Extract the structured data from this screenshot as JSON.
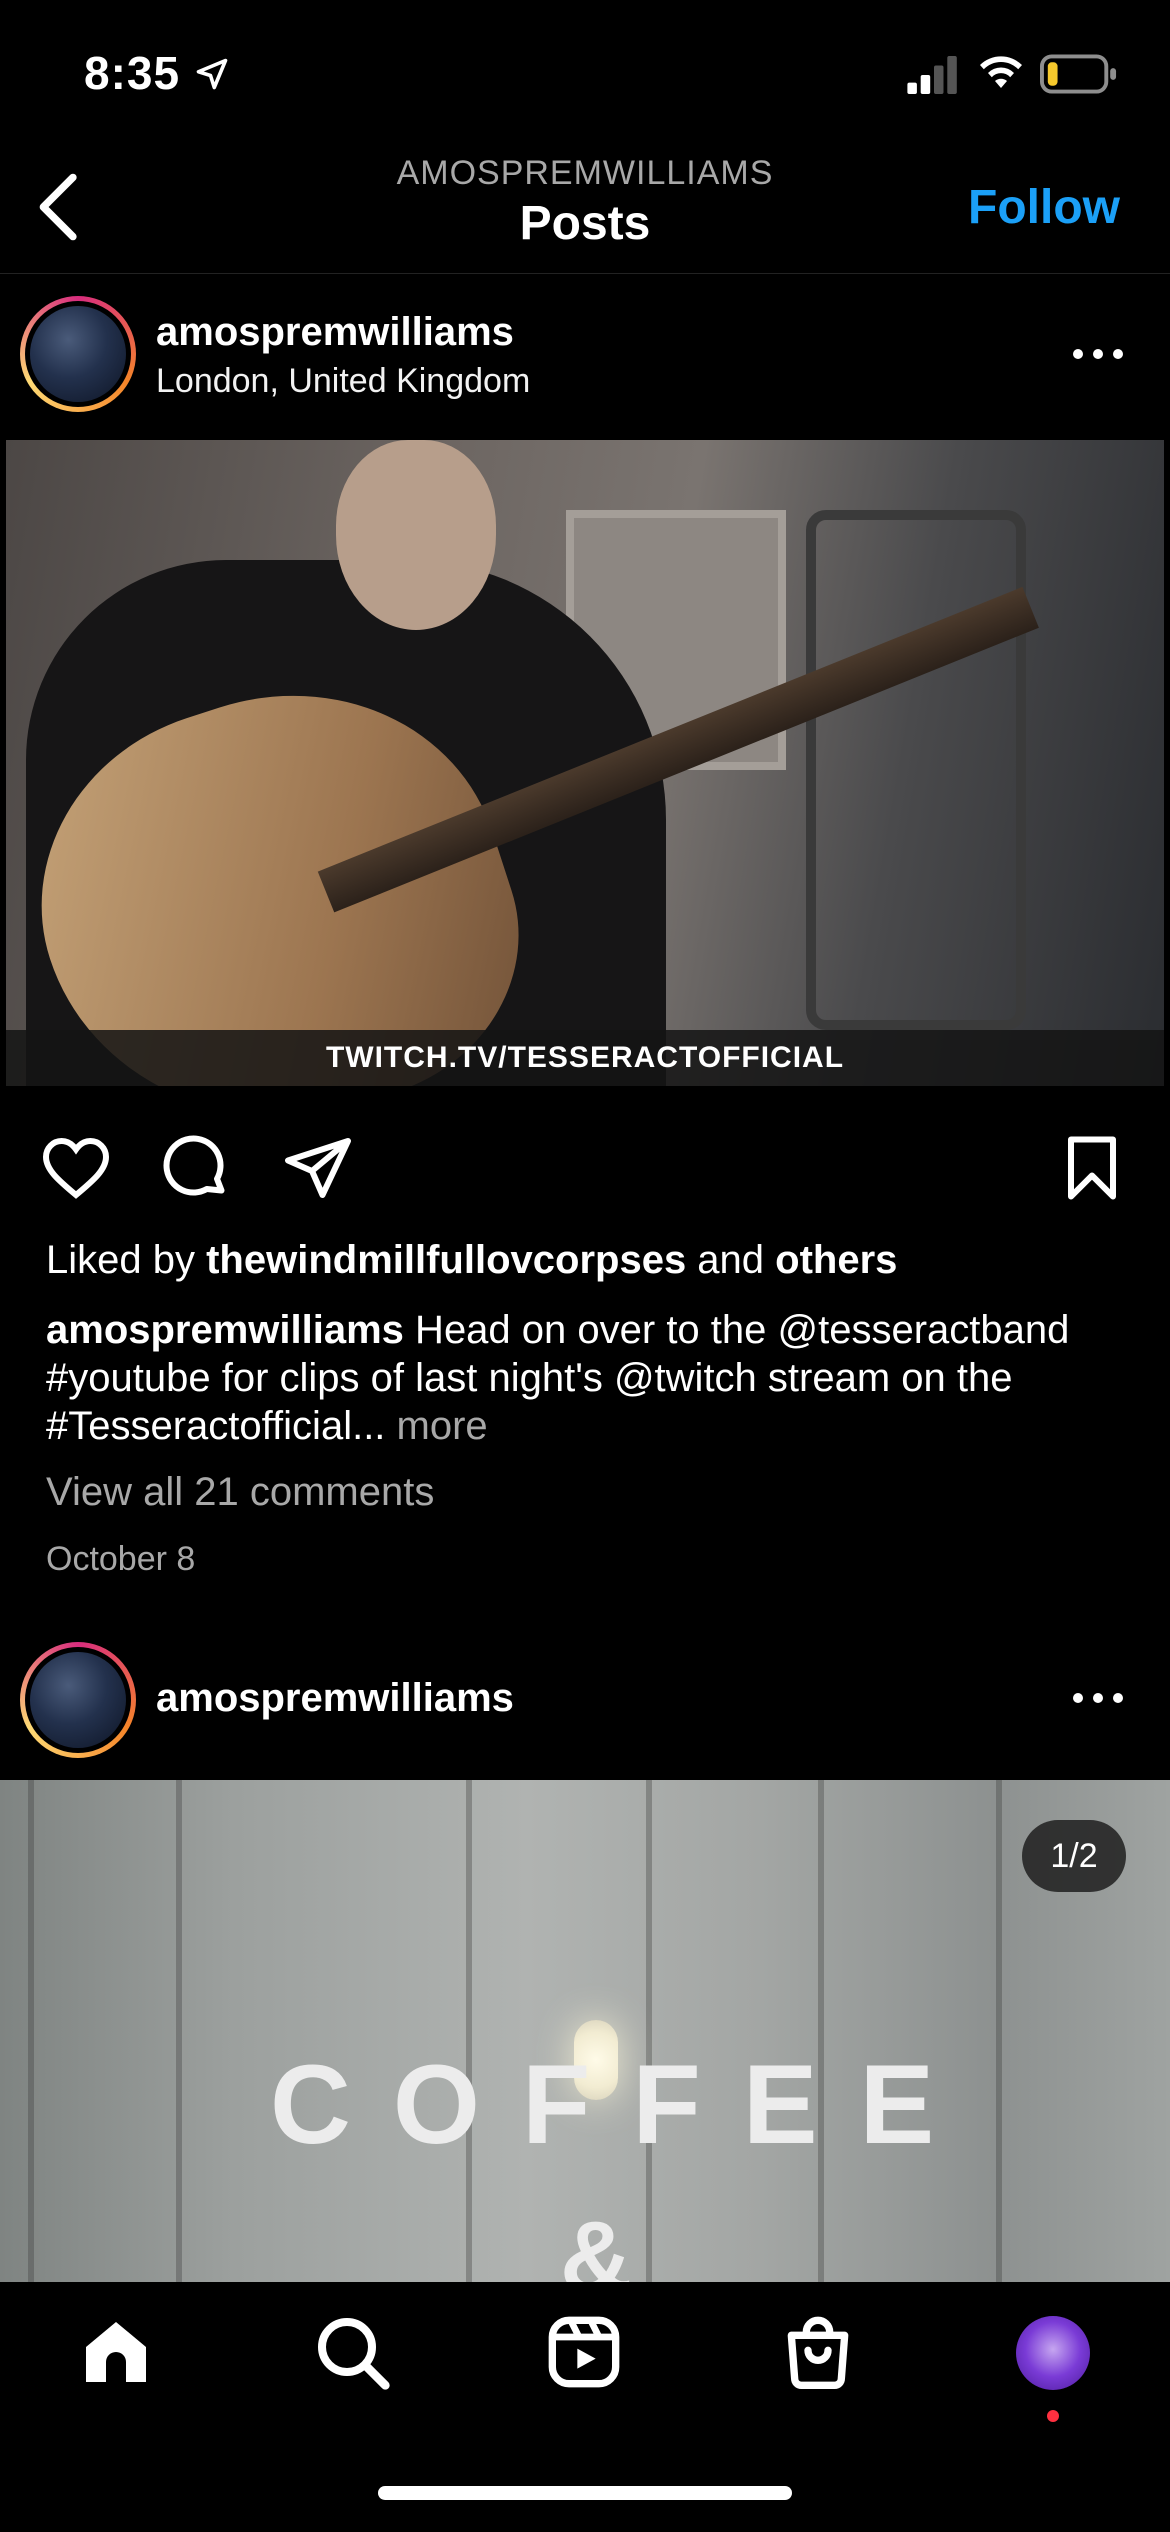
{
  "status_bar": {
    "time": "8:35"
  },
  "header": {
    "username": "AMOSPREMWILLIAMS",
    "title": "Posts",
    "follow_label": "Follow"
  },
  "posts": [
    {
      "username": "amospremwilliams",
      "location": "London, United Kingdom",
      "image_overlay_text": "TWITCH.TV/TESSERACTOFFICIAL",
      "liked_by_prefix": "Liked by ",
      "liked_by_user": "thewindmillfullovcorpses",
      "liked_by_middle": " and ",
      "liked_by_others": "others",
      "caption_user": "amospremwilliams",
      "caption_text": " Head on over to the @tesseractband #youtube for clips of last night's @twitch stream on the #Tesseractofficial...",
      "caption_more": " more",
      "view_comments": "View all 21 comments",
      "date": "October 8"
    },
    {
      "username": "amospremwilliams",
      "page_counter": "1/2",
      "image_text_1": "COFFEE",
      "image_text_2": "&"
    }
  ],
  "tab_bar": {
    "items": [
      "home-icon",
      "search-icon",
      "reels-icon",
      "shop-icon",
      "profile-avatar"
    ]
  },
  "colors": {
    "accent": "#1ba0f7",
    "notification": "#ff3040"
  }
}
